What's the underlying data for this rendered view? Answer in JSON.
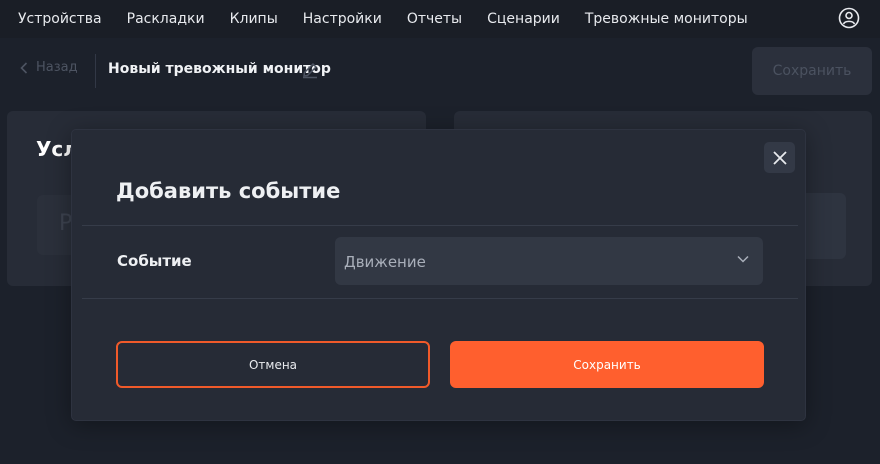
{
  "nav": {
    "items": [
      "Устройства",
      "Раскладки",
      "Клипы",
      "Настройки",
      "Отчеты",
      "Сценарии",
      "Тревожные мониторы"
    ]
  },
  "subheader": {
    "back_label": "Назад",
    "title": "Новый тревожный монитор",
    "save_label": "Сохранить"
  },
  "left_panel": {
    "title": "Усл",
    "ghost_char": "Р"
  },
  "modal": {
    "title": "Добавить событие",
    "field_label": "Событие",
    "select_value": "Движение",
    "cancel_label": "Отмена",
    "save_label": "Сохранить"
  },
  "colors": {
    "accent": "#ff5f2e",
    "background": "#1c212b",
    "panel": "#272c37"
  }
}
